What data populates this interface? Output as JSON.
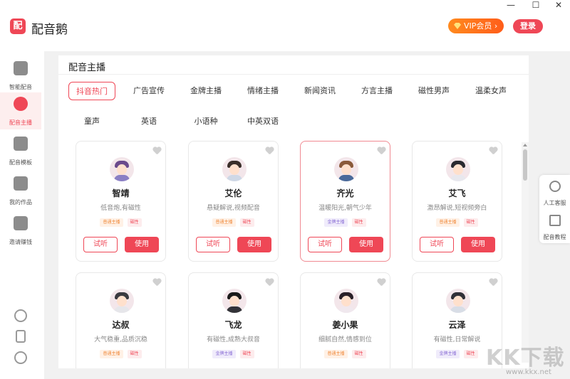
{
  "app": {
    "logo_char": "配",
    "title": "配音鹅",
    "vip_label": "VIP会员 ›",
    "login_label": "登录"
  },
  "window_controls": {
    "minimize": "—",
    "maximize": "☐",
    "close": "✕"
  },
  "sidebar": {
    "items": [
      {
        "label": "智能配音",
        "icon": "speaker-icon"
      },
      {
        "label": "配音主播",
        "icon": "anchor-icon",
        "active": true
      },
      {
        "label": "配音模板",
        "icon": "template-icon"
      },
      {
        "label": "我的作品",
        "icon": "folder-icon"
      },
      {
        "label": "邀请赚钱",
        "icon": "money-bag-icon"
      }
    ],
    "bottom_icons": [
      "tiktok-icon",
      "phone-icon",
      "settings-icon"
    ]
  },
  "panel": {
    "title": "配音主播"
  },
  "tabs": [
    {
      "label": "抖音热门",
      "active": true
    },
    {
      "label": "广告宣传"
    },
    {
      "label": "金牌主播"
    },
    {
      "label": "情绪主播"
    },
    {
      "label": "新闻资讯"
    },
    {
      "label": "方言主播"
    },
    {
      "label": "磁性男声"
    },
    {
      "label": "温柔女声"
    },
    {
      "label": "童声"
    },
    {
      "label": "英语"
    },
    {
      "label": "小语种"
    },
    {
      "label": "中英双语"
    }
  ],
  "buttons": {
    "listen": "试听",
    "use": "使用"
  },
  "anchors": [
    {
      "name": "智靖",
      "desc": "低音炮,有磁性",
      "tags": [
        {
          "text": "普通主播",
          "color": "orange"
        },
        {
          "text": "磁性",
          "color": "pink"
        }
      ],
      "hair": "#6b4a8c",
      "shirt": "#8a7fc4"
    },
    {
      "name": "艾伦",
      "desc": "悬疑解说,视频配音",
      "tags": [
        {
          "text": "普通主播",
          "color": "orange"
        },
        {
          "text": "磁性",
          "color": "pink"
        }
      ],
      "hair": "#3a2f2a",
      "shirt": "#cfd8e6"
    },
    {
      "name": "齐光",
      "desc": "温暖阳光,朝气少年",
      "tags": [
        {
          "text": "金牌主播",
          "color": "purple"
        },
        {
          "text": "磁性",
          "color": "pink"
        }
      ],
      "hair": "#8a5a3a",
      "shirt": "#4a6a9a",
      "selected": true
    },
    {
      "name": "艾飞",
      "desc": "激昂解说,短视频旁白",
      "tags": [
        {
          "text": "普通主播",
          "color": "orange"
        },
        {
          "text": "磁性",
          "color": "pink"
        }
      ],
      "hair": "#2a2a30",
      "shirt": "#e8e8ee"
    },
    {
      "name": "达叔",
      "desc": "大气稳重,品质沉稳",
      "tags": [
        {
          "text": "普通主播",
          "color": "orange"
        },
        {
          "text": "磁性",
          "color": "pink"
        }
      ],
      "hair": "#3a3a40",
      "shirt": "#e6e6ea"
    },
    {
      "name": "飞龙",
      "desc": "有磁性,成熟大叔音",
      "tags": [
        {
          "text": "金牌主播",
          "color": "purple"
        },
        {
          "text": "磁性",
          "color": "pink"
        }
      ],
      "hair": "#1a1a1a",
      "shirt": "#333338"
    },
    {
      "name": "姜小果",
      "desc": "细腻自然,情感到位",
      "tags": [
        {
          "text": "普通主播",
          "color": "orange"
        },
        {
          "text": "磁性",
          "color": "pink"
        }
      ],
      "hair": "#2a2028",
      "shirt": "#f0e8ee"
    },
    {
      "name": "云泽",
      "desc": "有磁性,日常解说",
      "tags": [
        {
          "text": "金牌主播",
          "color": "purple"
        },
        {
          "text": "磁性",
          "color": "pink"
        }
      ],
      "hair": "#303038",
      "shirt": "#d8dde6"
    }
  ],
  "right_dock": [
    {
      "label": "人工客服",
      "icon": "headset-icon"
    },
    {
      "label": "配音教程",
      "icon": "book-icon"
    }
  ],
  "watermark": {
    "text": "KK下载",
    "url": "www.kkx.net"
  }
}
